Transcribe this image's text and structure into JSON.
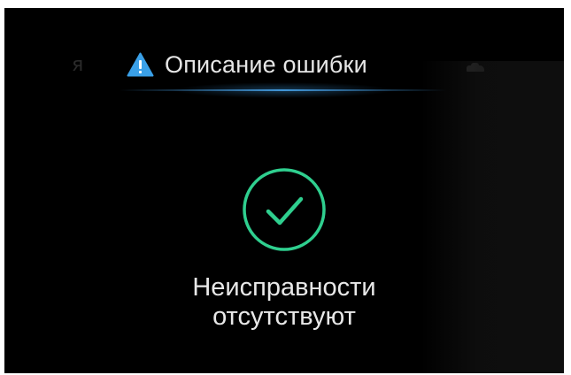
{
  "tabs": {
    "previous_partial": "я",
    "active": {
      "icon": "warning-triangle-icon",
      "title": "Описание ошибки"
    },
    "next_icon": "car-icon"
  },
  "status": {
    "icon": "check-circle-icon",
    "line1": "Неисправности",
    "line2": "отсутствуют"
  },
  "colors": {
    "accent_blue": "#3aa0e8",
    "check_green": "#2fcf8f",
    "background": "#000000",
    "text": "#e8e8e8"
  }
}
